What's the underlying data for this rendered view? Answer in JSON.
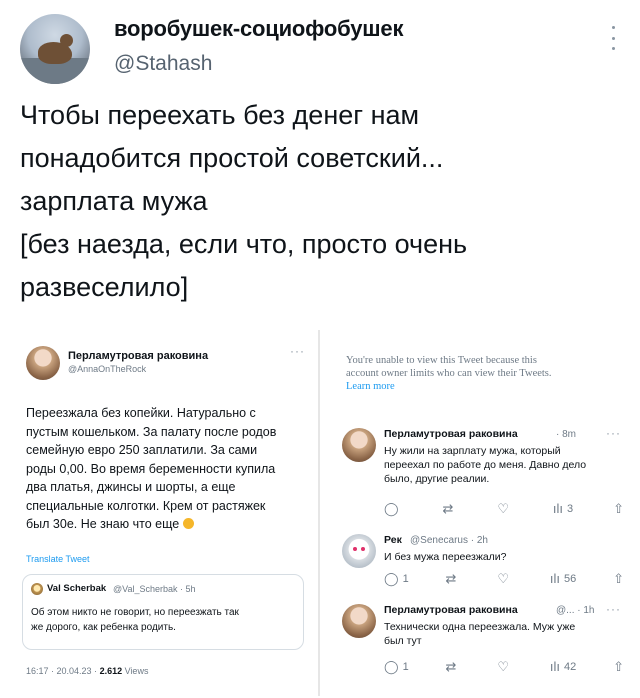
{
  "tweet": {
    "name": "воробушек-социофобушек",
    "handle": "@Stahash",
    "text_lines": [
      "Чтобы переехать без денег нам",
      "понадобится простой советский...",
      "зарплата мужа",
      "[без наезда, если что, просто очень",
      "развеселило]"
    ]
  },
  "left": {
    "name": "Перламутровая раковина",
    "handle": "@AnnaOnTheRock",
    "body_lines": [
      "Переезжала без копейки. Натурально с",
      "пустым кошельком. За палату после родов",
      "семейную евро 250 заплатили. За сами",
      "роды 0,00. Во время беременности купила",
      "два платья, джинсы и шорты, а еще",
      "специальные колготки. Крем от растяжек",
      "был 30е. Не знаю что еще"
    ],
    "translate": "Translate Tweet",
    "quote_name": "Val Scherbak",
    "quote_handle": "@Val_Scherbak · 5h",
    "quote_lines": [
      "Об этом никто не говорит, но переезжать так",
      "же дорого, как ребенка родить."
    ],
    "meta_time": "16:17 · 20.04.23 · ",
    "meta_views_count": "2.612",
    "meta_views_label": " Views"
  },
  "right": {
    "notice_lines": [
      "You're unable to view this Tweet because this",
      "account owner limits who can view their Tweets."
    ],
    "learn_more": "Learn more",
    "replies": [
      {
        "name": "Перламутровая раковина",
        "handle": "· 8m",
        "lines": [
          "Ну жили на зарплату мужа, который",
          "переехал по работе до меня. Давно дело",
          "было, другие реалии."
        ],
        "reply": "",
        "retweet": "",
        "like": "",
        "views": "3"
      },
      {
        "name": "Рек",
        "handle": "@Senecarus · 2h",
        "lines": [
          "И без мужа переезжали?"
        ],
        "reply": "1",
        "retweet": "",
        "like": "",
        "views": "56"
      },
      {
        "name": "Перламутровая раковина",
        "handle": "@... · 1h",
        "lines": [
          "Технически одна переезжала. Муж уже",
          "был тут"
        ],
        "reply": "1",
        "retweet": "",
        "like": "",
        "views": "42"
      }
    ]
  },
  "icons": {
    "reply": "reply-icon",
    "retweet": "retweet-icon",
    "like": "heart-icon",
    "views": "views-icon",
    "share": "share-icon"
  },
  "colors": {
    "link": "#1d9bf0",
    "muted": "#6e7a86"
  }
}
